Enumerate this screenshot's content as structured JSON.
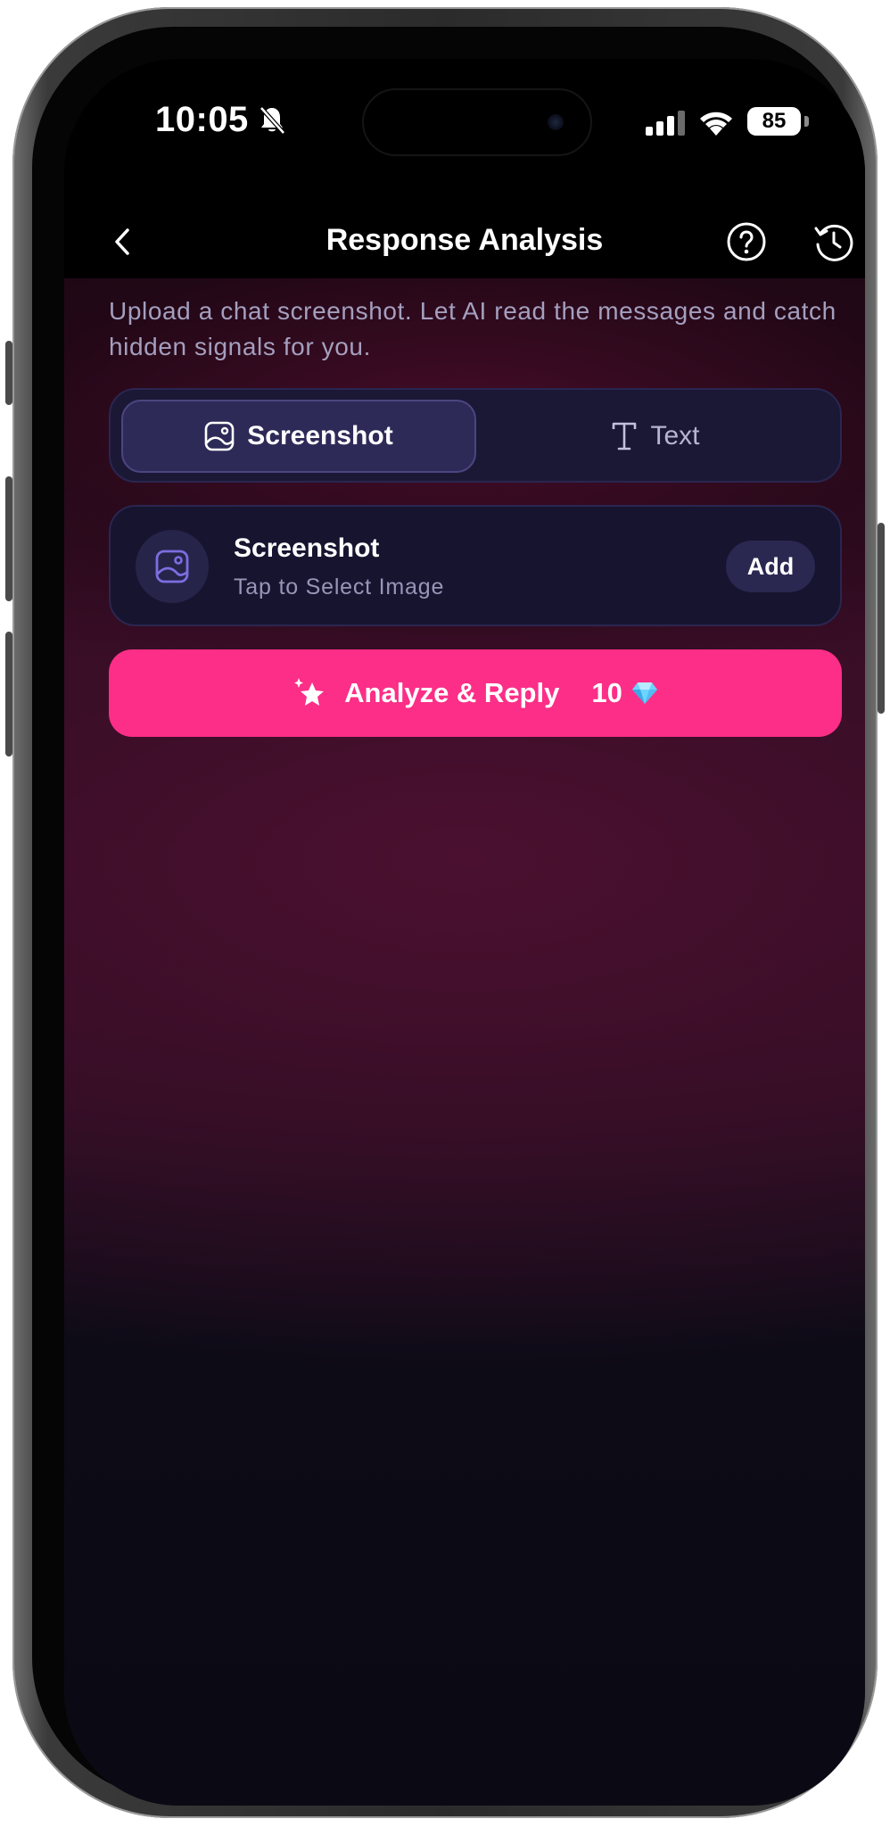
{
  "status_bar": {
    "time": "10:05",
    "battery": "85",
    "icons": [
      "bell-slash-icon",
      "signal-icon",
      "wifi-icon",
      "battery-icon"
    ]
  },
  "header": {
    "title": "Response Analysis",
    "icons": [
      "back-chevron-icon",
      "help-circle-icon",
      "history-icon"
    ]
  },
  "intro": {
    "text": "Upload a chat screenshot. Let AI read the messages and catch hidden signals for you."
  },
  "mode_tabs": [
    {
      "label": "Screenshot",
      "icon": "image-icon",
      "selected": true
    },
    {
      "label": "Text",
      "icon": "text-icon",
      "selected": false
    }
  ],
  "upload": {
    "title": "Screenshot",
    "subtitle": "Tap to Select Image",
    "add_label": "Add",
    "icon": "image-icon"
  },
  "analyze": {
    "label": "Analyze & Reply",
    "cost": "10",
    "icons": [
      "sparkle-star-icon",
      "gem-icon"
    ]
  },
  "colors": {
    "accent": "#fc2e87",
    "card_bg": "#171430",
    "tab_active_bg": "#2e2a58",
    "glow": "#3e0f2a",
    "base_bg": "#0b0a14",
    "muted_text": "#a49fbf"
  }
}
